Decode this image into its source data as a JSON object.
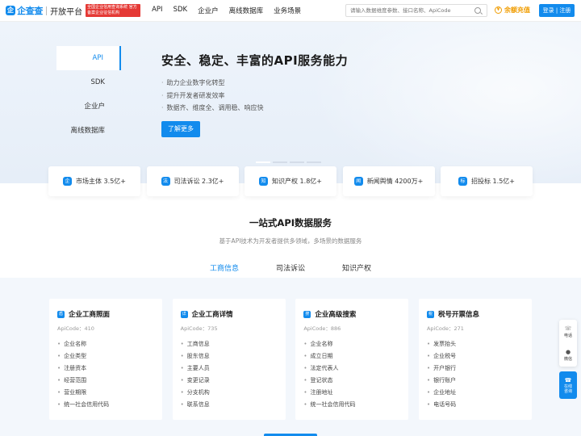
{
  "header": {
    "logo_mark": "企",
    "logo_text": "企查查",
    "logo_sub": "开放平台",
    "badge": "全国企业信用查询系统 官方备案企业征信机构",
    "nav": [
      "API",
      "SDK",
      "企业户",
      "离线数据库",
      "业务场景"
    ],
    "search_placeholder": "请输入数据维度参数、接口名称、ApiCode",
    "balance_icon": "¥",
    "balance_label": "余额充值",
    "login_label": "登录 | 注册"
  },
  "hero": {
    "sidebar": [
      "API",
      "SDK",
      "企业户",
      "离线数据库"
    ],
    "title": "安全、稳定、丰富的API服务能力",
    "bullets": [
      "助力企业数字化转型",
      "提升开发者研发效率",
      "数据齐、维度全、调用稳、响应快"
    ],
    "button": "了解更多"
  },
  "stats": [
    {
      "icon": "stats-market-icon",
      "glyph": "企",
      "label": "市场主体 3.5亿+"
    },
    {
      "icon": "stats-judicial-icon",
      "glyph": "法",
      "label": "司法诉讼 2.3亿+"
    },
    {
      "icon": "stats-ip-icon",
      "glyph": "知",
      "label": "知识产权 1.8亿+"
    },
    {
      "icon": "stats-news-icon",
      "glyph": "闻",
      "label": "新闻舆情 4200万+"
    },
    {
      "icon": "stats-bid-icon",
      "glyph": "标",
      "label": "招投标 1.5亿+"
    }
  ],
  "section": {
    "title": "一站式API数据服务",
    "subtitle": "基于API技术为开发者提供多领域，多场景的数据服务",
    "tabs": [
      "工商信息",
      "司法诉讼",
      "知识产权"
    ]
  },
  "cards": [
    {
      "title": "企业工商照面",
      "glyph": "盾",
      "code": "ApiCode：410",
      "items": [
        "企业名称",
        "企业类型",
        "注册资本",
        "经营范围",
        "营业期限",
        "统一社会信用代码"
      ]
    },
    {
      "title": "企业工商详情",
      "glyph": "详",
      "code": "ApiCode：735",
      "items": [
        "工商信息",
        "股东信息",
        "主要人员",
        "变更记录",
        "分支机构",
        "联系信息"
      ]
    },
    {
      "title": "企业高级搜索",
      "glyph": "搜",
      "code": "ApiCode：886",
      "items": [
        "企业名称",
        "成立日期",
        "法定代表人",
        "登记状态",
        "注册地址",
        "统一社会信用代码"
      ]
    },
    {
      "title": "税号开票信息",
      "glyph": "税",
      "code": "ApiCode：271",
      "items": [
        "发票抬头",
        "企业税号",
        "开户银行",
        "银行账户",
        "企业地址",
        "电话号码"
      ]
    }
  ],
  "float": {
    "phone_label": "电话",
    "wechat_label": "微信",
    "cs_label": "在线咨询"
  },
  "colors": {
    "primary": "#128bed",
    "badge": "#e53935",
    "balance": "#f09c00"
  }
}
